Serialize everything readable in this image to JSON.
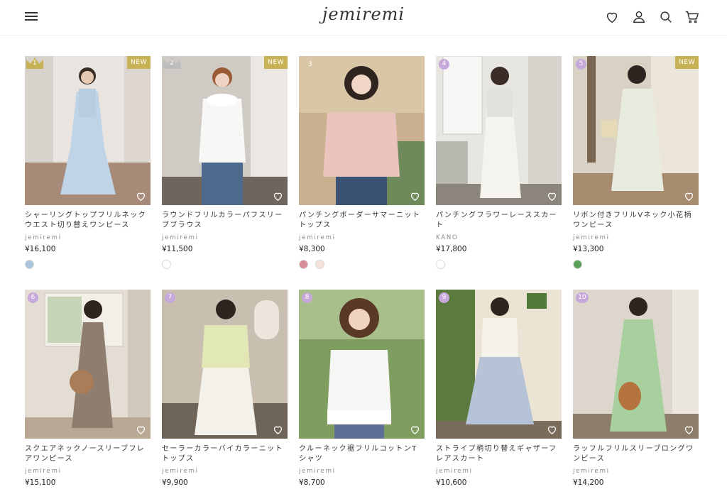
{
  "header": {
    "logo": "jemiremi",
    "icons": [
      "menu-icon",
      "heart-icon",
      "user-icon",
      "search-icon",
      "cart-icon"
    ]
  },
  "products": [
    {
      "rank": "1",
      "badge": "NEW",
      "name": "シャーリングトップフリルネックウエスト切り替えワンピース",
      "brand": "jemiremi",
      "price": "¥16,100",
      "swatches": [
        "#a9c4dc"
      ]
    },
    {
      "rank": "2",
      "badge": "NEW",
      "name": "ラウンドフリルカラーパフスリーブブラウス",
      "brand": "jemiremi",
      "price": "¥11,500",
      "swatches": [
        "#ffffff"
      ]
    },
    {
      "rank": "3",
      "badge": "",
      "name": "パンチングボーダーサマーニットトップス",
      "brand": "jemiremi",
      "price": "¥8,300",
      "swatches": [
        "#d98f9a",
        "#f6e3dc"
      ]
    },
    {
      "rank": "4",
      "badge": "",
      "name": "パンチングフラワーレーススカート",
      "brand": "KANO",
      "price": "¥17,800",
      "swatches": [
        "#ffffff"
      ]
    },
    {
      "rank": "5",
      "badge": "NEW",
      "name": "リボン付きフリルVネック小花柄ワンピース",
      "brand": "jemiremi",
      "price": "¥13,300",
      "swatches": [
        "#5aa05a"
      ]
    },
    {
      "rank": "6",
      "badge": "",
      "name": "スクエアネックノースリーブフレアワンピース",
      "brand": "jemiremi",
      "price": "¥15,100",
      "swatches": []
    },
    {
      "rank": "7",
      "badge": "",
      "name": "セーラーカラーバイカラーニットトップス",
      "brand": "jemiremi",
      "price": "¥9,900",
      "swatches": []
    },
    {
      "rank": "8",
      "badge": "",
      "name": "クルーネック裾フリルコットンTシャツ",
      "brand": "jemiremi",
      "price": "¥8,700",
      "swatches": []
    },
    {
      "rank": "9",
      "badge": "",
      "name": "ストライプ柄切り替えギャザーフレアスカート",
      "brand": "jemiremi",
      "price": "¥10,600",
      "swatches": []
    },
    {
      "rank": "10",
      "badge": "",
      "name": "ラッフルフリルスリーブロングワンピース",
      "brand": "jemiremi",
      "price": "¥14,200",
      "swatches": []
    }
  ],
  "colors": {
    "new_badge": "#c7b256",
    "rank_gold": "#c7b256",
    "rank_silver": "#bdbdbd",
    "rank_purple": "#c6a9da"
  }
}
